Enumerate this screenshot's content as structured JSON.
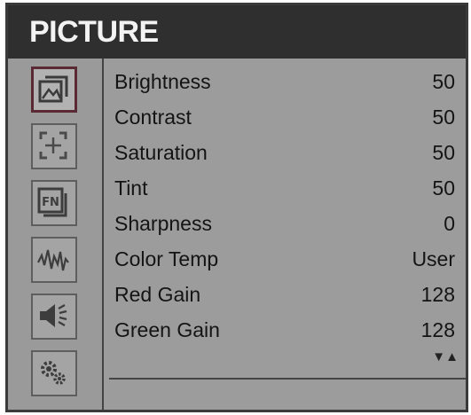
{
  "menu": {
    "title": "PICTURE",
    "icons": [
      {
        "name": "picture-icon",
        "selected": true
      },
      {
        "name": "marker-icon",
        "selected": false
      },
      {
        "name": "function-key-icon",
        "selected": false
      },
      {
        "name": "waveform-icon",
        "selected": false
      },
      {
        "name": "audio-icon",
        "selected": false
      },
      {
        "name": "settings-icon",
        "selected": false
      }
    ],
    "items": [
      {
        "label": "Brightness",
        "value": "50"
      },
      {
        "label": "Contrast",
        "value": "50"
      },
      {
        "label": "Saturation",
        "value": "50"
      },
      {
        "label": "Tint",
        "value": "50"
      },
      {
        "label": "Sharpness",
        "value": "0"
      },
      {
        "label": "Color Temp",
        "value": "User"
      },
      {
        "label": "Red Gain",
        "value": "128"
      },
      {
        "label": "Green Gain",
        "value": "128"
      }
    ],
    "scroll_indicator": "▼▲"
  },
  "colors": {
    "title_bar": "#2f2f2f",
    "panel": "#9c9c9c",
    "selected_border": "#5a2a34",
    "text": "#141414"
  }
}
